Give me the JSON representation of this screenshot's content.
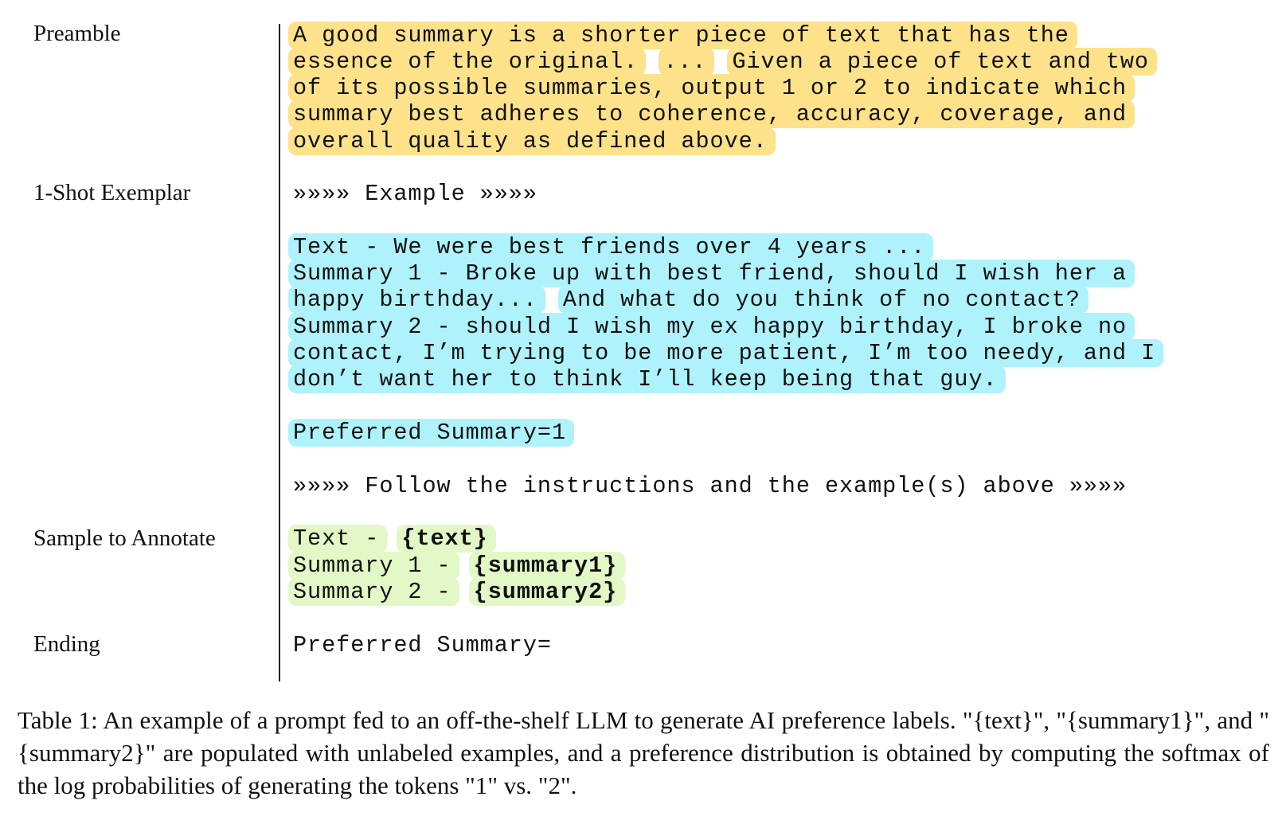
{
  "labels": {
    "preamble": "Preamble",
    "exemplar": "1-Shot Exemplar",
    "sample": "Sample to Annotate",
    "ending": "Ending"
  },
  "preamble": {
    "line1": "A good summary is a shorter piece of text that has the",
    "line2a": "essence of the original.",
    "line2b": "...",
    "line2c": "Given a piece of text and two",
    "line3": "of its possible summaries, output 1 or 2 to indicate which",
    "line4": "summary best adheres to coherence, accuracy, coverage, and",
    "line5": "overall quality as defined above."
  },
  "exemplar": {
    "header": "»»»» Example »»»»",
    "text_line": "Text - We were best friends over 4 years ...",
    "s1_line1": "Summary 1 - Broke up with best friend, should I wish her a",
    "s1_line2a": "happy birthday...",
    "s1_line2b": "And what do you think of no contact?",
    "s2_line1": "Summary 2 - should I wish my ex happy birthday, I broke no",
    "s2_line2": "contact, I’m trying to be more patient, I’m too needy, and I",
    "s2_line3": "don’t want her to think I’ll keep being that guy.",
    "preferred": "Preferred Summary=1",
    "follow": "»»»» Follow the instructions and the example(s) above »»»»"
  },
  "sample": {
    "text_prefix": "Text -",
    "text_var": "{text}",
    "s1_prefix": "Summary 1 -",
    "s1_var": "{summary1}",
    "s2_prefix": "Summary 2 -",
    "s2_var": "{summary2}"
  },
  "ending": {
    "line": "Preferred Summary="
  },
  "caption": "Table 1: An example of a prompt fed to an off-the-shelf LLM to generate AI preference labels. \"{text}\", \"{summary1}\", and \"{summary2}\" are populated with unlabeled examples, and a preference distribution is obtained by computing the softmax of the log probabilities of generating the tokens \"1\" vs. \"2\".",
  "colors": {
    "preamble_highlight": "#fde28a",
    "exemplar_highlight": "#aef3fb",
    "sample_highlight": "#e2f8c6"
  }
}
